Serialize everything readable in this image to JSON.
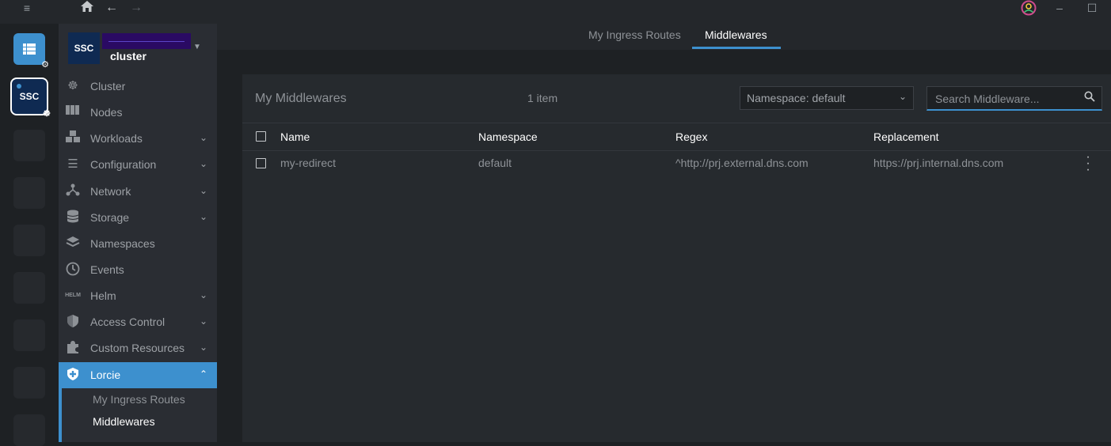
{
  "titlebar": {
    "menu_icon": "hamburger-icon",
    "home_icon": "home-icon",
    "back_icon": "arrow-left-icon",
    "forward_icon": "arrow-right-icon",
    "user_icon": "user-avatar-icon",
    "minimize_icon": "minimize-icon",
    "maximize_icon": "maximize-icon"
  },
  "hotbar": {
    "active_cluster_label": "SSC"
  },
  "sidebar": {
    "cluster": {
      "avatar_label": "SSC",
      "name": "cluster"
    },
    "items": [
      {
        "label": "Cluster",
        "icon": "helm-wheel-icon",
        "expandable": false
      },
      {
        "label": "Nodes",
        "icon": "server-icon",
        "expandable": false
      },
      {
        "label": "Workloads",
        "icon": "cubes-icon",
        "expandable": true
      },
      {
        "label": "Configuration",
        "icon": "list-icon",
        "expandable": true
      },
      {
        "label": "Network",
        "icon": "network-icon",
        "expandable": true
      },
      {
        "label": "Storage",
        "icon": "database-icon",
        "expandable": true
      },
      {
        "label": "Namespaces",
        "icon": "layers-icon",
        "expandable": false
      },
      {
        "label": "Events",
        "icon": "clock-icon",
        "expandable": false
      },
      {
        "label": "Helm",
        "icon": "helm-icon",
        "expandable": true
      },
      {
        "label": "Access Control",
        "icon": "shield-icon",
        "expandable": true
      },
      {
        "label": "Custom Resources",
        "icon": "puzzle-icon",
        "expandable": true
      },
      {
        "label": "Lorcie",
        "icon": "shield-plus-icon",
        "expandable": true,
        "active": true
      }
    ],
    "submenu": [
      {
        "label": "My Ingress Routes"
      },
      {
        "label": "Middlewares"
      }
    ]
  },
  "tabs": [
    {
      "label": "My Ingress Routes"
    },
    {
      "label": "Middlewares",
      "active": true
    }
  ],
  "panel": {
    "title": "My Middlewares",
    "count": "1 item",
    "namespace_select": "Namespace: default",
    "search_placeholder": "Search Middleware..."
  },
  "table": {
    "headers": [
      "Name",
      "Namespace",
      "Regex",
      "Replacement"
    ],
    "rows": [
      [
        "my-redirect",
        "default",
        "^http://prj.external.dns.com",
        "https://prj.internal.dns.com"
      ]
    ]
  },
  "colors": {
    "accent": "#3d90ce",
    "background": "#1e2124",
    "sidebar": "#2a2d33"
  }
}
